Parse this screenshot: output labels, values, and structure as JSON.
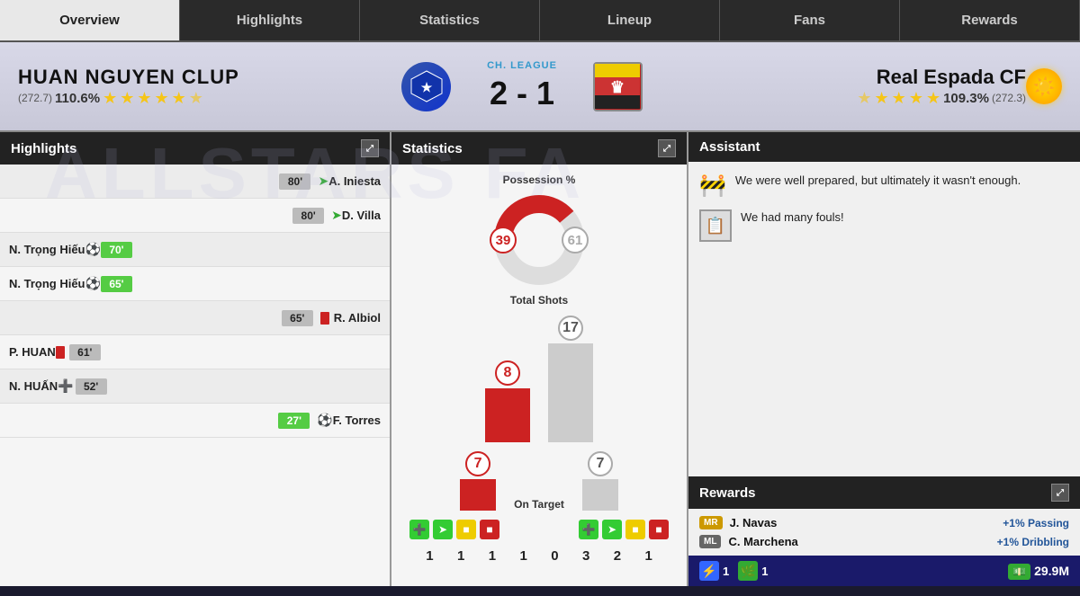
{
  "tabs": [
    {
      "label": "Overview",
      "active": true
    },
    {
      "label": "Highlights",
      "active": false
    },
    {
      "label": "Statistics",
      "active": false
    },
    {
      "label": "Lineup",
      "active": false
    },
    {
      "label": "Fans",
      "active": false
    },
    {
      "label": "Rewards",
      "active": false
    }
  ],
  "match": {
    "home_team": "HUAN NGUYEN CLUP",
    "home_rating": "110.6%",
    "home_points": "272.7",
    "home_stars": 5,
    "away_team": "Real Espada CF",
    "away_rating": "109.3%",
    "away_points": "272.3",
    "away_stars": 4,
    "competition": "CH. LEAGUE",
    "score": "2 - 1"
  },
  "highlights": {
    "title": "Highlights",
    "expand_icon": "⤢",
    "events": [
      {
        "time": "80'",
        "type": "sub",
        "player": "A. Iniesta",
        "side": "right"
      },
      {
        "time": "80'",
        "type": "sub",
        "player": "D. Villa",
        "side": "right"
      },
      {
        "time": "70'",
        "type": "goal",
        "player": "N. Trọng Hiếu",
        "side": "left"
      },
      {
        "time": "65'",
        "type": "goal",
        "player": "N. Trọng Hiếu",
        "side": "left"
      },
      {
        "time": "65'",
        "type": "red_card",
        "player": "R. Albiol",
        "side": "right"
      },
      {
        "time": "61'",
        "type": "red_card",
        "player": "P. HUAN",
        "side": "left"
      },
      {
        "time": "52'",
        "type": "medic",
        "player": "N. HUẤN",
        "side": "left"
      },
      {
        "time": "27'",
        "type": "goal",
        "player": "F. Torres",
        "side": "right"
      }
    ]
  },
  "statistics": {
    "title": "Statistics",
    "expand_icon": "⤢",
    "possession_label": "Possession %",
    "home_possession": 39,
    "away_possession": 61,
    "shots_label": "Total Shots",
    "home_shots": 8,
    "away_shots": 17,
    "on_target_label": "On Target",
    "home_on_target": 7,
    "away_on_target": 7,
    "home_stats": [
      1,
      1,
      1,
      1
    ],
    "away_stats": [
      0,
      3,
      2,
      1
    ]
  },
  "assistant": {
    "title": "Assistant",
    "messages": [
      {
        "icon": "🚧",
        "text": "We were well prepared, but ultimately it wasn't enough."
      },
      {
        "icon": "📋",
        "text": "We had many fouls!"
      }
    ]
  },
  "rewards": {
    "title": "Rewards",
    "expand_icon": "⤢",
    "items": [
      {
        "badge": "MR",
        "name": "J. Navas",
        "bonus": "+1% Passing"
      },
      {
        "badge": "ML",
        "name": "C. Marchena",
        "bonus": "+1% Dribbling"
      }
    ],
    "bottom": {
      "lightning_count": 1,
      "green_count": 1,
      "money_amount": "29.9M"
    }
  }
}
